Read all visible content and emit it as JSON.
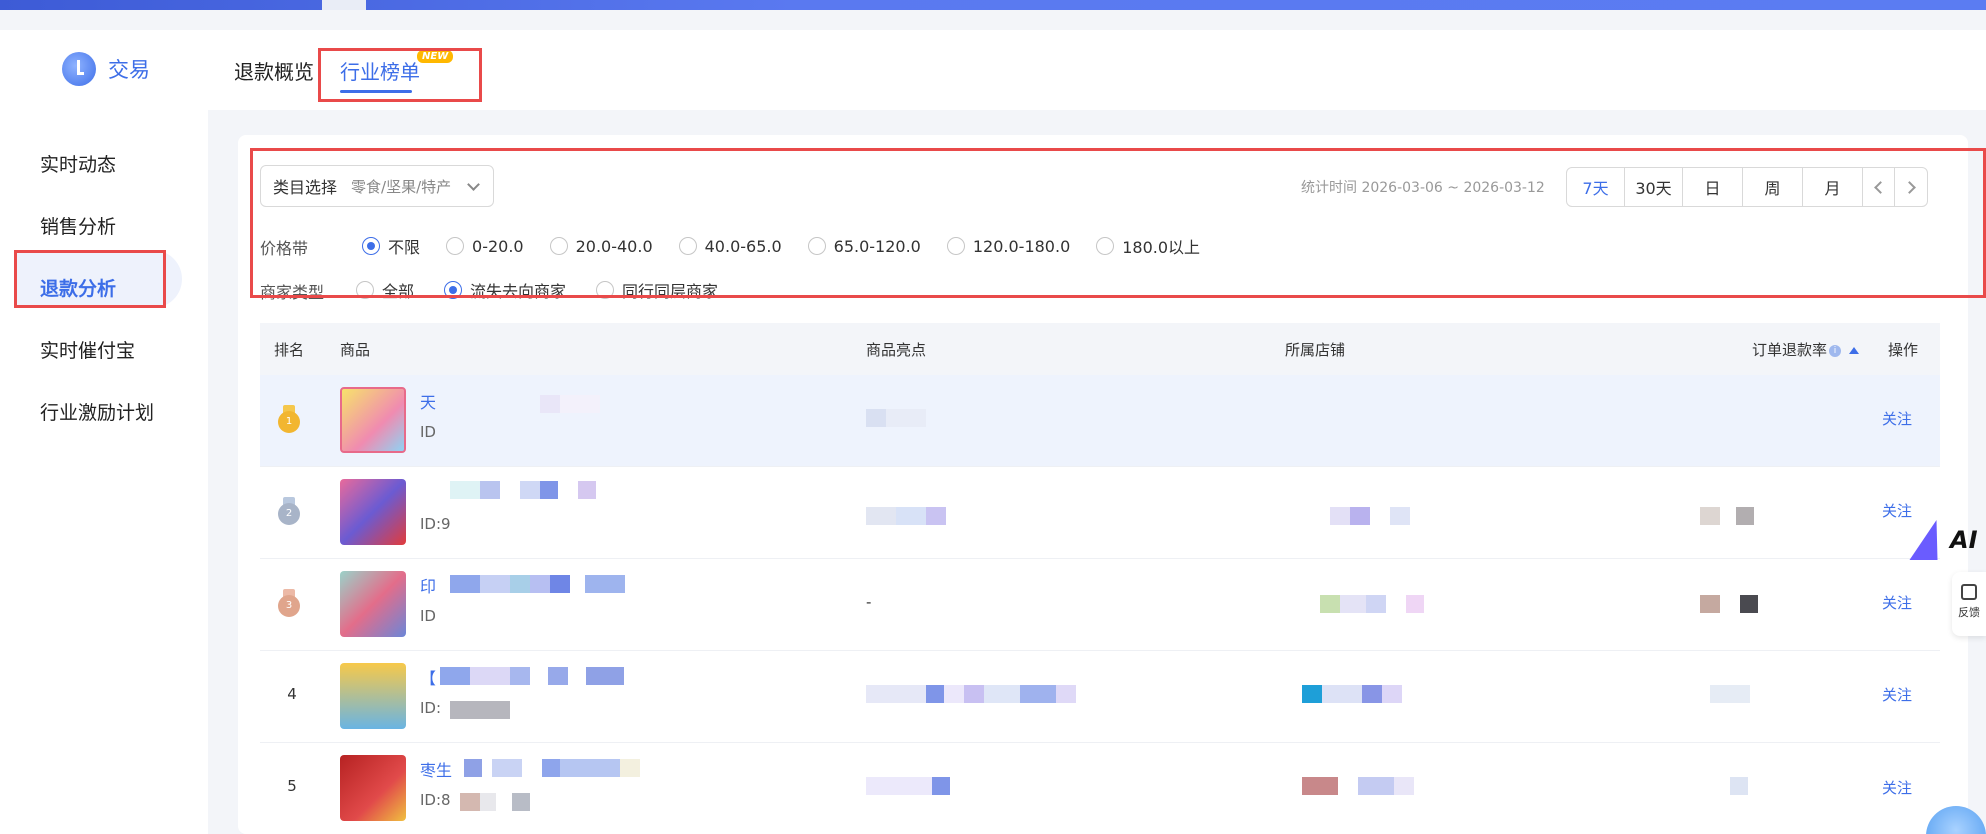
{
  "header": {
    "logo_text": "交易",
    "tabs": [
      {
        "label": "退款概览"
      },
      {
        "label": "行业榜单"
      }
    ],
    "new_badge": "NEW"
  },
  "sidebar": {
    "items": [
      {
        "label": "实时动态"
      },
      {
        "label": "销售分析"
      },
      {
        "label": "退款分析"
      },
      {
        "label": "实时催付宝"
      },
      {
        "label": "行业激励计划"
      }
    ]
  },
  "filters": {
    "category_label": "类目选择",
    "category_value": "零食/坚果/特产",
    "stat_time": "统计时间 2026-03-06 ~ 2026-03-12",
    "periods": [
      "7天",
      "30天",
      "日",
      "周",
      "月"
    ],
    "active_period": "7天",
    "price_band_label": "价格带",
    "price_bands": [
      "不限",
      "0-20.0",
      "20.0-40.0",
      "40.0-65.0",
      "65.0-120.0",
      "120.0-180.0",
      "180.0以上"
    ],
    "merchant_type_label": "商家类型",
    "merchant_types": [
      "全部",
      "流失去向商家",
      "同行同层商家"
    ]
  },
  "table": {
    "headers": {
      "rank": "排名",
      "product": "商品",
      "highlights": "商品亮点",
      "shop": "所属店铺",
      "refund_rate": "订单退款率",
      "action": "操作"
    },
    "rows": [
      {
        "rank": "1",
        "name": "天",
        "id": "ID",
        "highlight": "",
        "action": "关注"
      },
      {
        "rank": "2",
        "name": "",
        "id": "ID:9",
        "highlight": "",
        "action": "关注"
      },
      {
        "rank": "3",
        "name": "印",
        "id": "ID",
        "highlight": "-",
        "action": "关注"
      },
      {
        "rank": "4",
        "name": "【",
        "id": "ID:",
        "highlight": "",
        "action": "关注"
      },
      {
        "rank": "5",
        "name": "枣生",
        "id": "ID:8",
        "highlight": "",
        "action": "关注"
      }
    ]
  },
  "floating": {
    "ai_label": "AI",
    "feedback_label": "反馈"
  },
  "colors": {
    "accent": "#3d6ee8",
    "highlight_box": "#e94a4a",
    "gold": "#f2b630",
    "silver": "#a8b4c8",
    "bronze": "#e0a58c"
  }
}
